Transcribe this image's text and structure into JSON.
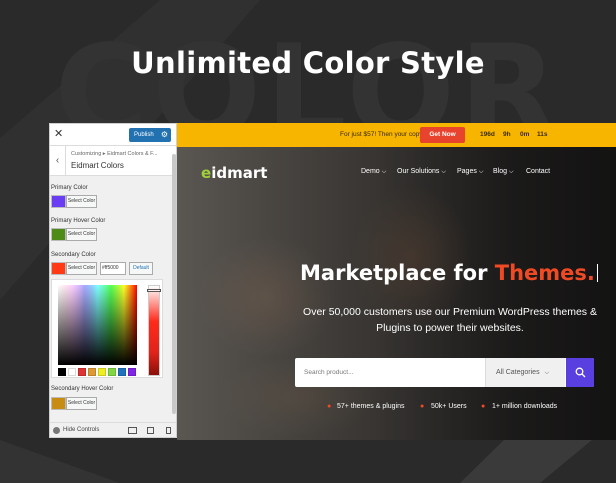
{
  "background": {
    "headline": "Unlimited Color Style",
    "watermark_word": "COLOR"
  },
  "customizer": {
    "close_icon": "close-icon",
    "publish_label": "Publish",
    "breadcrumb": "Customizing ▸ Eidmart Colors & F...",
    "section_title": "Eidmart Colors",
    "fields": [
      {
        "label": "Primary Color",
        "button": "Select Color",
        "color": "#6a3df5"
      },
      {
        "label": "Primary Hover Color",
        "button": "Select Color",
        "color": "#4d8a16"
      },
      {
        "label": "Secondary Color",
        "button": "Select Color",
        "color": "#ff3a14",
        "hex": "#ff5000",
        "default_label": "Default"
      },
      {
        "label": "Secondary Hover Color",
        "button": "Select Color",
        "color": "#c98c12"
      }
    ],
    "palette": [
      "#000000",
      "#ffffff",
      "#dd3333",
      "#dd9933",
      "#eeee22",
      "#81d742",
      "#1e73be",
      "#8224e3"
    ],
    "hide_controls": "Hide Controls",
    "devices": [
      "desktop-icon",
      "tablet-icon",
      "mobile-icon"
    ]
  },
  "site": {
    "topbar": {
      "text": "For just $57! Then your copy",
      "cta": "Get Now",
      "countdown": [
        "196d",
        "9h",
        "0m",
        "11s"
      ]
    },
    "logo": {
      "initial": "e",
      "rest": "idmart"
    },
    "nav": [
      "Demo",
      "Our Solutions",
      "Pages",
      "Blog",
      "Contact"
    ],
    "hero": {
      "title_main": "Marketplace for ",
      "title_accent": "Themes.",
      "subtitle": "Over 50,000 customers use our Premium WordPress themes & Plugins to power their websites."
    },
    "search": {
      "placeholder": "Search product...",
      "category": "All Categories"
    },
    "features": [
      "57+ themes & plugins",
      "50k+ Users",
      "1+ million downloads"
    ],
    "accent_color": "#f04a24",
    "topbar_color": "#f7b500"
  }
}
